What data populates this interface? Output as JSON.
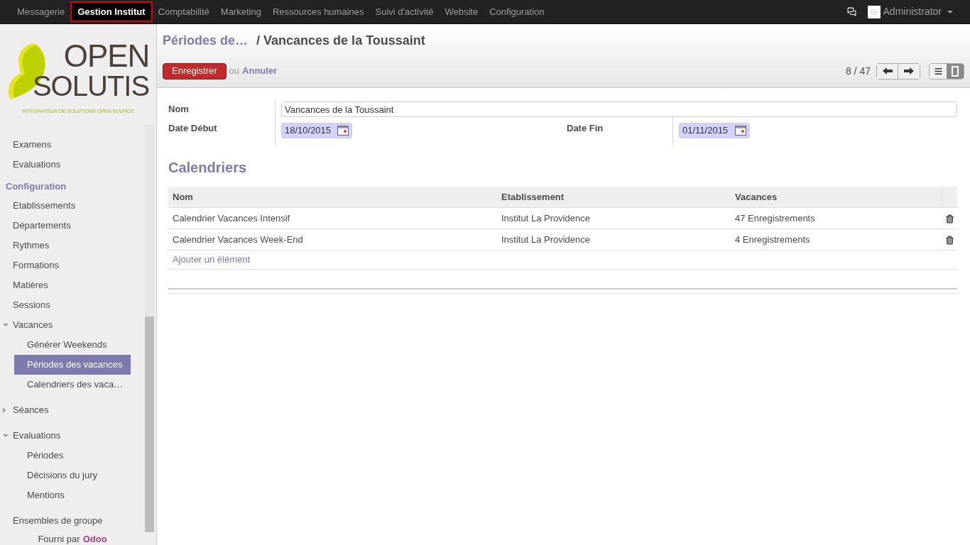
{
  "top_menu": [
    {
      "label": "Messagerie",
      "selected": false
    },
    {
      "label": "Gestion Institut",
      "selected": true
    },
    {
      "label": "Comptabilité",
      "selected": false
    },
    {
      "label": "Marketing",
      "selected": false
    },
    {
      "label": "Ressources humaines",
      "selected": false
    },
    {
      "label": "Suivi d'activité",
      "selected": false
    },
    {
      "label": "Website",
      "selected": false
    },
    {
      "label": "Configuration",
      "selected": false
    }
  ],
  "user": {
    "name": "Administrator"
  },
  "logo": {
    "line_1": "OPEN",
    "line_2": "SOLUTIS",
    "tagline": "INTEGRATEUR DE SOLUTIONS OPEN SOURCE"
  },
  "sidebar": {
    "items": [
      {
        "kind": "item",
        "label": "Examens",
        "selected": false
      },
      {
        "kind": "item",
        "label": "Evaluations",
        "selected": false
      },
      {
        "kind": "heading",
        "label": "Configuration"
      },
      {
        "kind": "item",
        "label": "Etablissements",
        "selected": false
      },
      {
        "kind": "item",
        "label": "Départements",
        "selected": false
      },
      {
        "kind": "item",
        "label": "Rythmes",
        "selected": false
      },
      {
        "kind": "item",
        "label": "Formations",
        "selected": false
      },
      {
        "kind": "item",
        "label": "Matières",
        "selected": false
      },
      {
        "kind": "item",
        "label": "Sessions",
        "selected": false
      },
      {
        "kind": "item",
        "label": "Vacances",
        "selected": false,
        "expanded": true,
        "children": [
          {
            "label": "Générer Weekends",
            "selected": false
          },
          {
            "label": "Périodes des vacances",
            "selected": true
          },
          {
            "label": "Calendriers des vaca…",
            "selected": false
          }
        ]
      },
      {
        "kind": "item",
        "label": "Séances",
        "selected": false,
        "expanded": false
      },
      {
        "kind": "item",
        "label": "Evaluations",
        "selected": false,
        "expanded": true,
        "children": [
          {
            "label": "Périodes",
            "selected": false
          },
          {
            "label": "Décisions du jury",
            "selected": false
          },
          {
            "label": "Mentions",
            "selected": false
          }
        ]
      },
      {
        "kind": "item",
        "label": "Ensembles de groupe",
        "selected": false
      }
    ],
    "footer_prefix": "Fourni par",
    "footer_brand": "Odoo"
  },
  "breadcrumb": {
    "parent": "Périodes de…",
    "current": "/ Vancances de la Toussaint"
  },
  "actions": {
    "save": "Enregistrer",
    "separator": "ou",
    "cancel": "Annuler"
  },
  "pager": {
    "text": "8 / 47"
  },
  "views": [
    {
      "kind": "list",
      "selected": false
    },
    {
      "kind": "form",
      "selected": true
    }
  ],
  "form": {
    "name_label": "Nom",
    "name_value": "Vancances de la Toussaint",
    "start_label": "Date Début",
    "start_value": "18/10/2015",
    "end_label": "Date Fin",
    "end_value": "01/11/2015"
  },
  "section_title": "Calendriers",
  "table": {
    "columns": [
      "Nom",
      "Etablissement",
      "Vacances"
    ],
    "rows": [
      [
        "Calendrier Vacances Intensif",
        "Institut La Providence",
        "47 Enregistrements"
      ],
      [
        "Calendrier Vacances Week-End",
        "Institut La Providence",
        "4 Enregistrements"
      ]
    ],
    "add_link": "Ajouter un élément"
  }
}
